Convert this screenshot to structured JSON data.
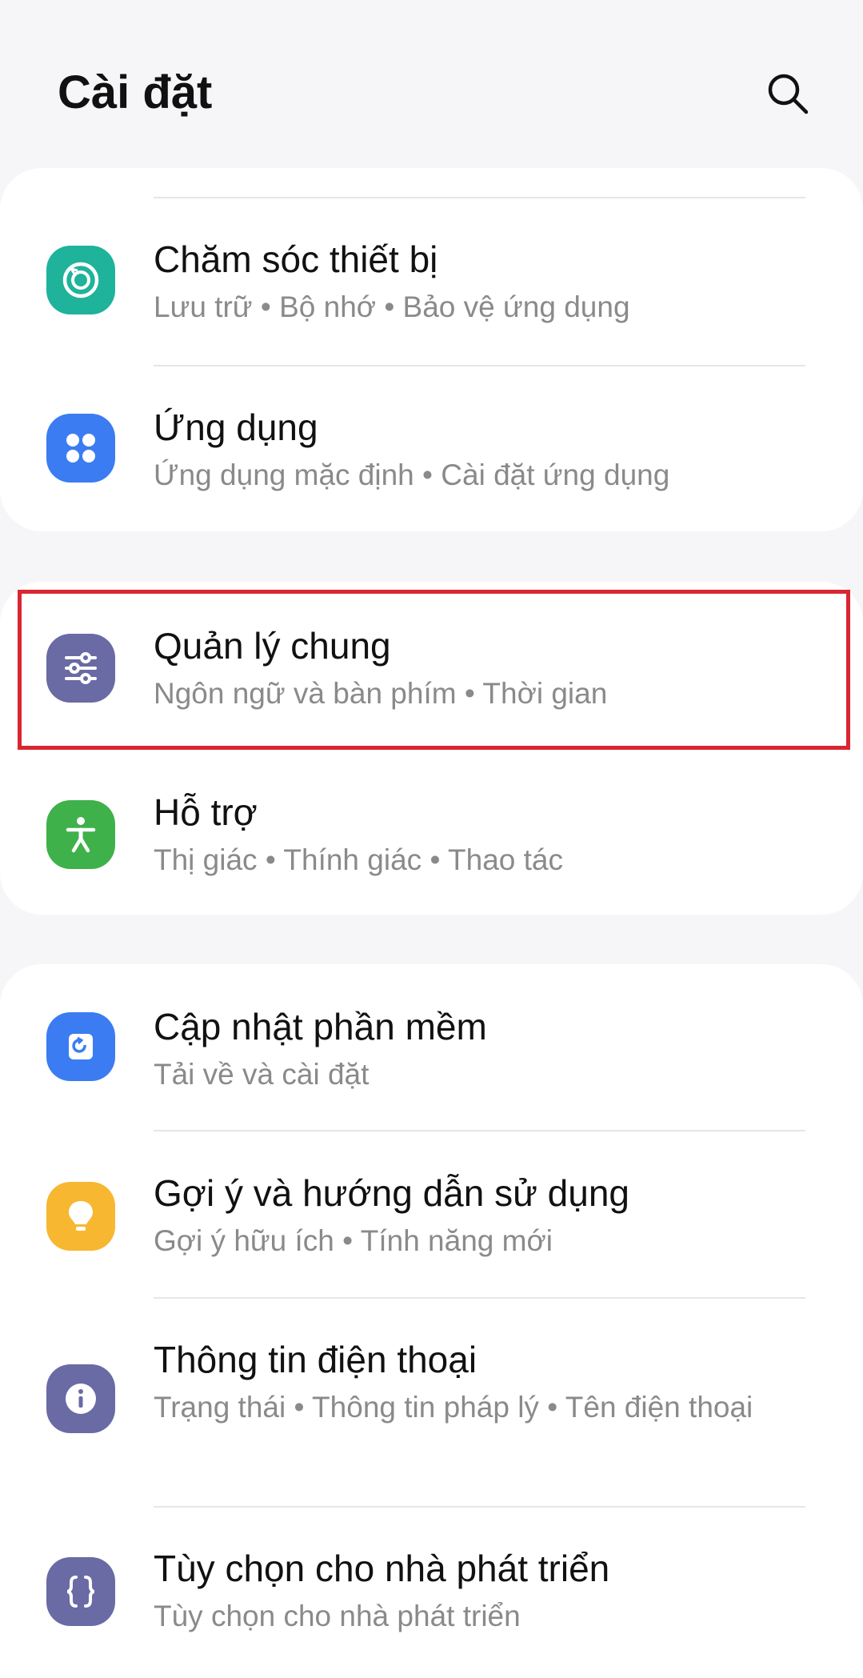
{
  "header": {
    "title": "Cài đặt"
  },
  "icons": {
    "search": "search-icon"
  },
  "colors": {
    "highlight": "#d92631"
  },
  "items": [
    {
      "label": "Chăm sóc thiết bị",
      "subtitle": "Lưu trữ  •  Bộ nhớ  •  Bảo vệ ứng dụng",
      "icon": "device-care-icon",
      "color": "#1fb39b"
    },
    {
      "label": "Ứng dụng",
      "subtitle": "Ứng dụng mặc định  •  Cài đặt ứng dụng",
      "icon": "apps-icon",
      "color": "#3b7cf2"
    },
    {
      "label": "Quản lý chung",
      "subtitle": "Ngôn ngữ và bàn phím  •  Thời gian",
      "icon": "sliders-icon",
      "color": "#6a6aa5"
    },
    {
      "label": "Hỗ trợ",
      "subtitle": "Thị giác  •  Thính giác  •  Thao tác",
      "icon": "accessibility-icon",
      "color": "#3fb14a"
    },
    {
      "label": "Cập nhật phần mềm",
      "subtitle": "Tải về và cài đặt",
      "icon": "software-update-icon",
      "color": "#3b7cf2"
    },
    {
      "label": "Gợi ý và hướng dẫn sử dụng",
      "subtitle": "Gợi ý hữu ích  •  Tính năng mới",
      "icon": "lightbulb-icon",
      "color": "#f7b731"
    },
    {
      "label": "Thông tin điện thoại",
      "subtitle": "Trạng thái  •  Thông tin pháp lý  •  Tên điện thoại",
      "icon": "info-icon",
      "color": "#6a6aa5"
    },
    {
      "label": "Tùy chọn cho nhà phát triển",
      "subtitle": "Tùy chọn cho nhà phát triển",
      "icon": "developer-braces-icon",
      "color": "#6a6aa5"
    }
  ]
}
